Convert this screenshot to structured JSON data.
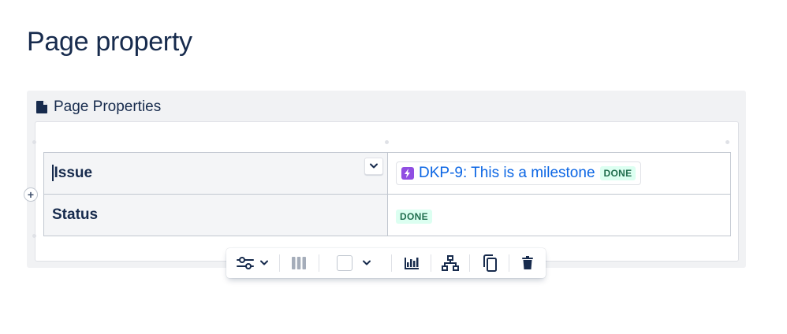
{
  "page": {
    "title": "Page property"
  },
  "macro": {
    "title": "Page Properties",
    "icon": "document-icon"
  },
  "table": {
    "rows": [
      {
        "key": "Issue",
        "issue_key": "DKP-9: This is a milestone",
        "issue_status": "DONE"
      },
      {
        "key": "Status",
        "status": "DONE"
      }
    ]
  },
  "toolbar": {
    "items": [
      "table-options-icon",
      "chevron-down-icon",
      "column-layout-icon",
      "background-color-icon",
      "chart-icon",
      "hierarchy-icon",
      "copy-icon",
      "delete-icon"
    ]
  },
  "colors": {
    "accent_link": "#0c66e4",
    "done_bg": "#dcfff1",
    "done_text": "#216e4e",
    "epic_purple": "#904ee2"
  }
}
